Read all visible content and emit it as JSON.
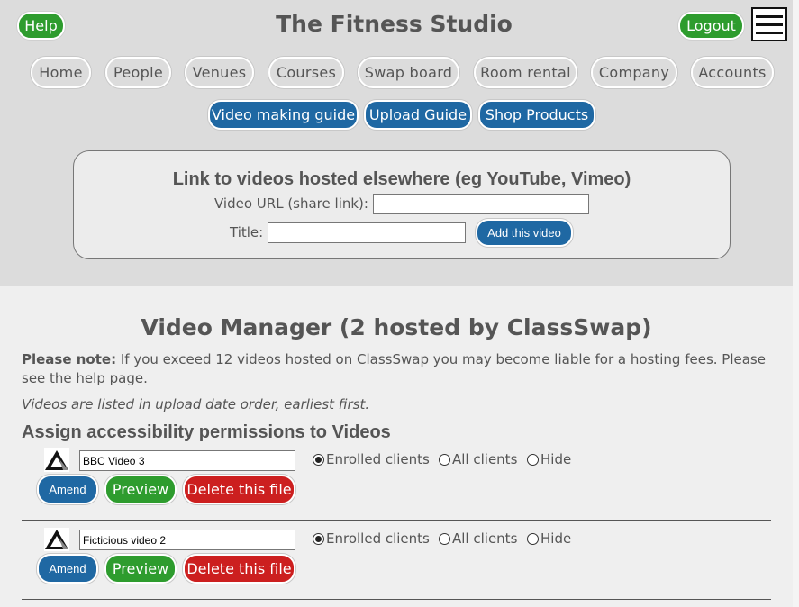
{
  "header": {
    "help_label": "Help",
    "title": "The Fitness Studio",
    "logout_label": "Logout",
    "menu_icon": "hamburger-menu-icon"
  },
  "nav": {
    "items": [
      "Home",
      "People",
      "Venues",
      "Courses",
      "Swap board",
      "Room rental",
      "Company",
      "Accounts"
    ],
    "guides": [
      "Video making guide",
      "Upload Guide",
      "Shop Products"
    ]
  },
  "link_form": {
    "heading": "Link to videos hosted elsewhere (eg YouTube, Vimeo)",
    "url_label": "Video URL (share link):",
    "url_value": "",
    "title_label": "Title:",
    "title_value": "",
    "add_label": "Add this video"
  },
  "manager": {
    "title": "Video Manager (2 hosted by ClassSwap)",
    "note_bold": "Please note:",
    "note_text": " If you exceed 12 videos hosted on ClassSwap you may become liable for a hosting fees. Please see the help page.",
    "order_note": "Videos are listed in upload date order, earliest first.",
    "assign_title": "Assign accessibility permissions to Videos"
  },
  "videos": [
    {
      "title": "BBC Video 3",
      "options": [
        "Enrolled clients",
        "All clients",
        "Hide"
      ],
      "selected": "Enrolled clients",
      "amend_label": "Amend",
      "preview_label": "Preview",
      "delete_label": "Delete this file"
    },
    {
      "title": "Ficticious video 2",
      "options": [
        "Enrolled clients",
        "All clients",
        "Hide"
      ],
      "selected": "Enrolled clients",
      "amend_label": "Amend",
      "preview_label": "Preview",
      "delete_label": "Delete this file"
    }
  ],
  "colors": {
    "green": "#2e9c2e",
    "blue": "#1f68a3",
    "red": "#cc1f1f",
    "header_bg": "#dcdcdc",
    "body_bg": "#efefef"
  }
}
